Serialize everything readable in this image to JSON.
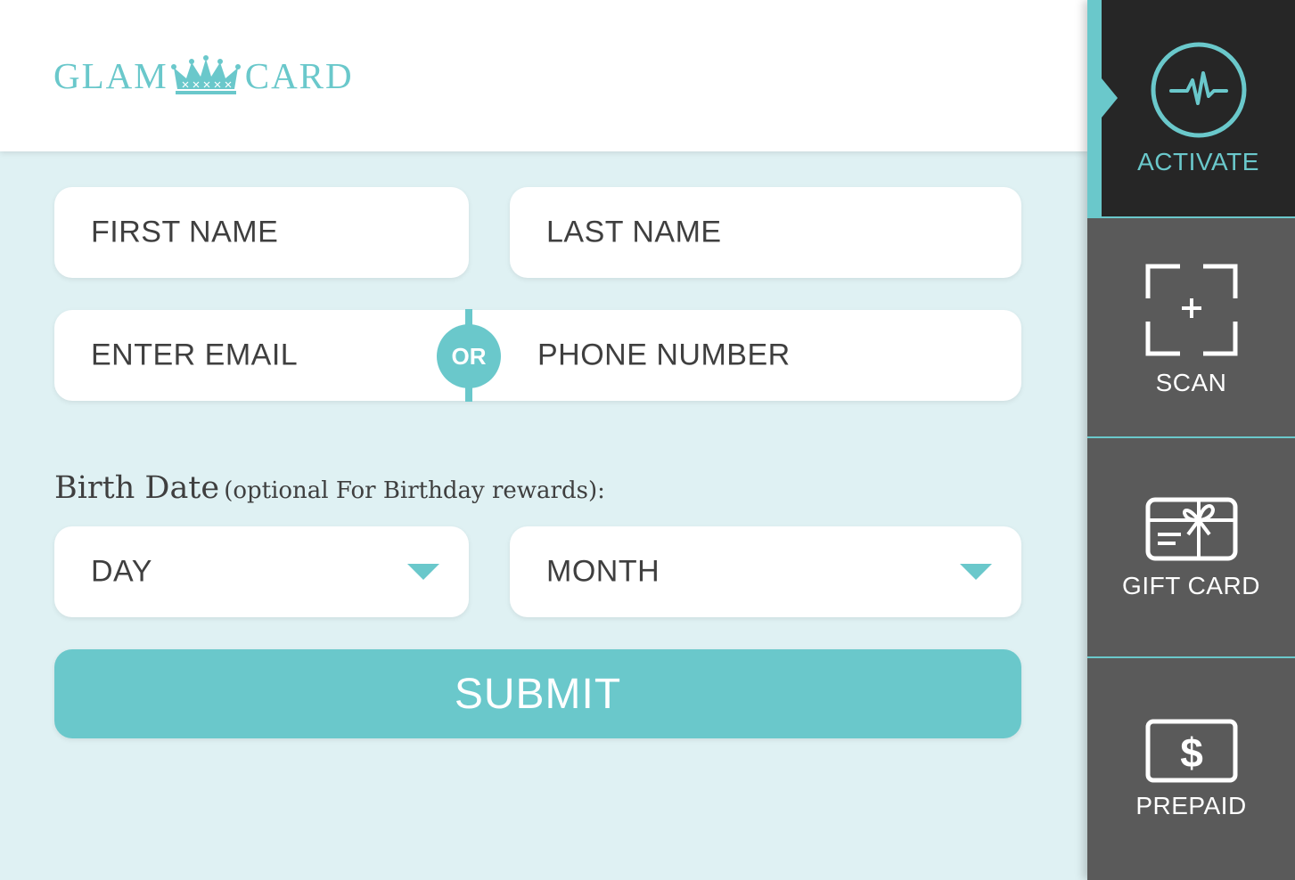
{
  "brand": {
    "logo_left": "GLAM",
    "logo_right": "CARD",
    "accent_color": "#6ac8cb"
  },
  "form": {
    "first_name_placeholder": "FIRST NAME",
    "last_name_placeholder": "LAST NAME",
    "email_placeholder": "ENTER EMAIL",
    "or_label": "OR",
    "phone_placeholder": "PHONE NUMBER",
    "birth_label_main": "Birth Date",
    "birth_label_note": "(optional For Birthday rewards):",
    "day_select": "DAY",
    "month_select": "MONTH",
    "submit_label": "SUBMIT"
  },
  "sidebar": {
    "items": [
      {
        "label": "ACTIVATE",
        "icon": "pulse-icon",
        "active": true
      },
      {
        "label": "SCAN",
        "icon": "scan-icon",
        "active": false
      },
      {
        "label": "GIFT CARD",
        "icon": "gift-card-icon",
        "active": false
      },
      {
        "label": "PREPAID",
        "icon": "dollar-card-icon",
        "active": false
      }
    ]
  }
}
